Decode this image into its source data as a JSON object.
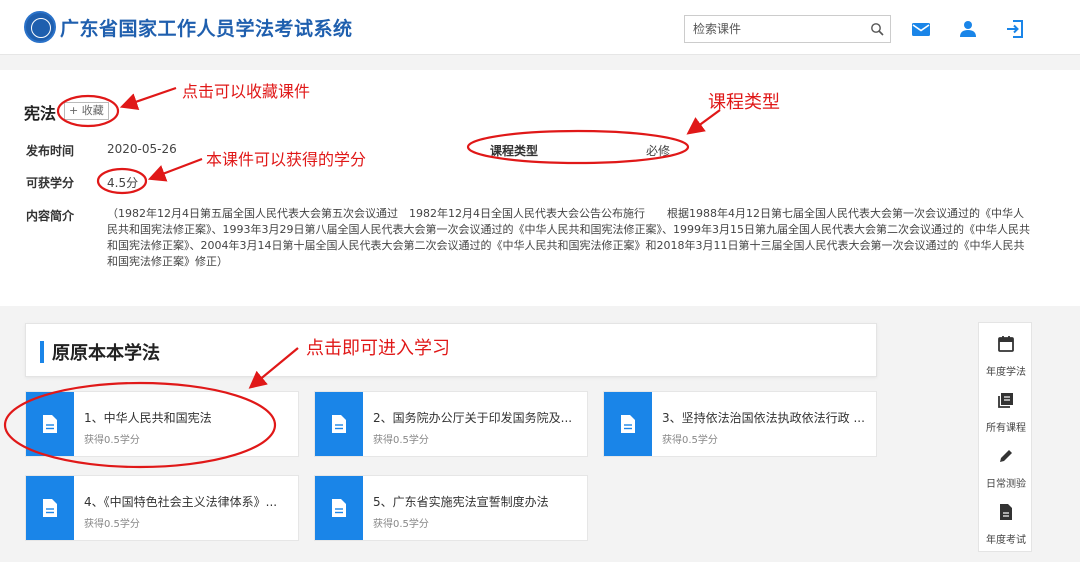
{
  "header": {
    "site_title": "广东省国家工作人员学法考试系统",
    "search_placeholder": "检索课件",
    "icons": [
      "search-icon",
      "mail-icon",
      "user-icon",
      "logout-icon"
    ],
    "accent_color": "#1a85e8"
  },
  "course": {
    "title": "宪法",
    "favorite_label": "+ 收藏",
    "publish_label": "发布时间",
    "publish_date": "2020-05-26",
    "credit_label": "可获学分",
    "credit_value": "4.5分",
    "type_label": "课程类型",
    "type_value": "必修",
    "intro_label": "内容简介",
    "intro_text": "（1982年12月4日第五届全国人民代表大会第五次会议通过　1982年12月4日全国人民代表大会公告公布施行　　根据1988年4月12日第七届全国人民代表大会第一次会议通过的《中华人民共和国宪法修正案》、1993年3月29日第八届全国人民代表大会第一次会议通过的《中华人民共和国宪法修正案》、1999年3月15日第九届全国人民代表大会第二次会议通过的《中华人民共和国宪法修正案》、2004年3月14日第十届全国人民代表大会第二次会议通过的《中华人民共和国宪法修正案》和2018年3月11日第十三届全国人民代表大会第一次会议通过的《中华人民共和国宪法修正案》修正）"
  },
  "annotations": {
    "favorite": "点击可以收藏课件",
    "course_type": "课程类型",
    "credit": "本课件可以获得的学分",
    "enter_study": "点击即可进入学习",
    "color": "#e01818"
  },
  "section": {
    "title": "原原本本学法",
    "cards": [
      {
        "title": "1、中华人民共和国宪法",
        "sub": "获得0.5学分"
      },
      {
        "title": "2、国务院办公厅关于印发国务院及...",
        "sub": "获得0.5学分"
      },
      {
        "title": "3、坚持依法治国依法执政依法行政 ...",
        "sub": "获得0.5学分"
      },
      {
        "title": "4、《中国特色社会主义法律体系》...",
        "sub": "获得0.5学分"
      },
      {
        "title": "5、广东省实施宪法宣誓制度办法",
        "sub": "获得0.5学分"
      }
    ]
  },
  "side_nav": {
    "items": [
      {
        "label": "年度学法",
        "icon": "calendar-icon"
      },
      {
        "label": "所有课程",
        "icon": "library-icon"
      },
      {
        "label": "日常测验",
        "icon": "pencil-icon"
      },
      {
        "label": "年度考试",
        "icon": "document-icon"
      }
    ]
  }
}
